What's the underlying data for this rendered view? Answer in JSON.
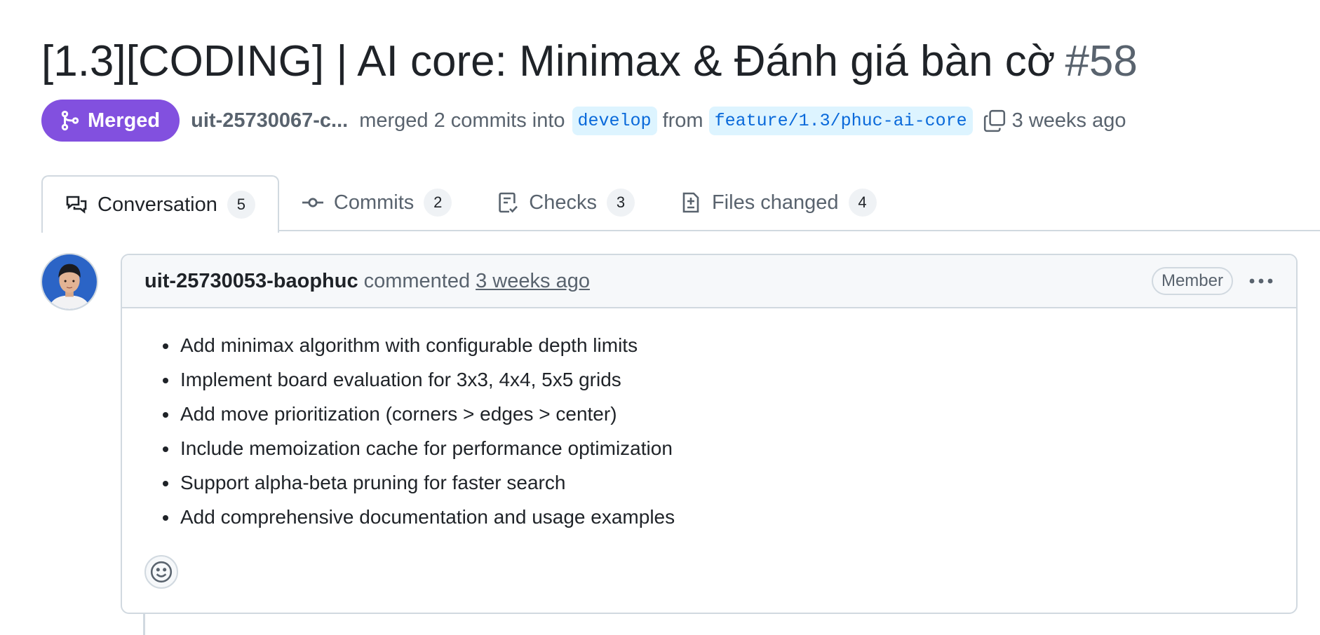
{
  "pr": {
    "title": "[1.3][CODING] | AI core: Minimax & Đánh giá bàn cờ",
    "number": "#58"
  },
  "meta": {
    "state_label": "Merged",
    "state_icon": "git-merge-icon",
    "author": "uit-25730067-c...",
    "merged_text": "merged 2 commits into",
    "base_branch": "develop",
    "from_text": "from",
    "head_branch": "feature/1.3/phuc-ai-core",
    "copy_icon": "copy-icon",
    "time": "3 weeks ago",
    "colors": {
      "merged": "#8250df",
      "branch_text": "#0969da",
      "branch_bg": "#ddf4ff"
    }
  },
  "tabs": [
    {
      "label": "Conversation",
      "count": "5",
      "icon": "conversation-icon",
      "active": true
    },
    {
      "label": "Commits",
      "count": "2",
      "icon": "commit-icon",
      "active": false
    },
    {
      "label": "Checks",
      "count": "3",
      "icon": "checklist-icon",
      "active": false
    },
    {
      "label": "Files changed",
      "count": "4",
      "icon": "file-diff-icon",
      "active": false
    }
  ],
  "comment": {
    "author": "uit-25730053-baophuc",
    "action": "commented",
    "time": "3 weeks ago",
    "badge": "Member",
    "menu_icon": "kebab-horizontal-icon",
    "items": [
      "Add minimax algorithm with configurable depth limits",
      "Implement board evaluation for 3x3, 4x4, 5x5 grids",
      "Add move prioritization (corners > edges > center)",
      "Include memoization cache for performance optimization",
      "Support alpha-beta pruning for faster search",
      "Add comprehensive documentation and usage examples"
    ],
    "reaction_icon": "smiley-icon"
  }
}
